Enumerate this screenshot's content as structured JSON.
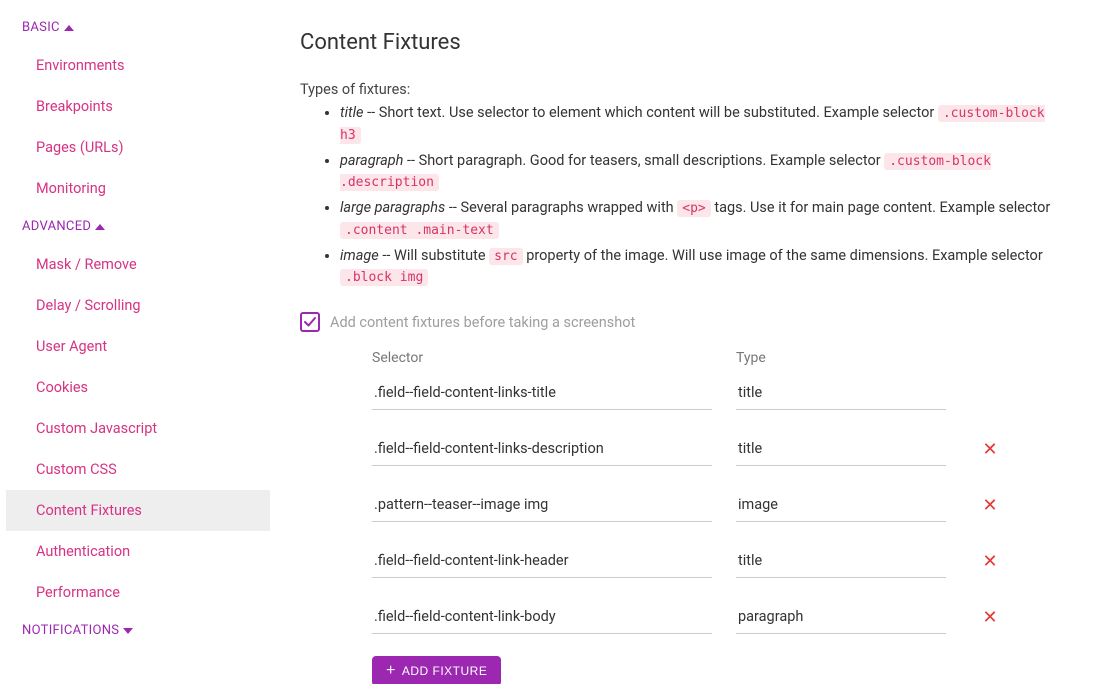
{
  "sidebar": {
    "sections": [
      {
        "label": "BASIC",
        "expanded": true,
        "items": [
          {
            "label": "Environments"
          },
          {
            "label": "Breakpoints"
          },
          {
            "label": "Pages (URLs)"
          },
          {
            "label": "Monitoring"
          }
        ]
      },
      {
        "label": "ADVANCED",
        "expanded": true,
        "items": [
          {
            "label": "Mask / Remove"
          },
          {
            "label": "Delay / Scrolling"
          },
          {
            "label": "User Agent"
          },
          {
            "label": "Cookies"
          },
          {
            "label": "Custom Javascript"
          },
          {
            "label": "Custom CSS"
          },
          {
            "label": "Content Fixtures",
            "active": true
          },
          {
            "label": "Authentication"
          },
          {
            "label": "Performance"
          }
        ]
      },
      {
        "label": "NOTIFICATIONS",
        "expanded": false,
        "items": []
      }
    ]
  },
  "page": {
    "title": "Content Fixtures",
    "intro": "Types of fixtures:",
    "types": [
      {
        "name": "title",
        "desc": " -- Short text. Use selector to element which content will be substituted. Example selector ",
        "code": ".custom-block h3"
      },
      {
        "name": "paragraph",
        "desc": " -- Short paragraph. Good for teasers, small descriptions. Example selector ",
        "code": ".custom-block .description"
      },
      {
        "name": "large paragraphs",
        "desc_pre": " -- Several paragraphs wrapped with ",
        "mid_code": "<p>",
        "desc_post": " tags. Use it for main page content. Example selector ",
        "code": ".content .main-text"
      },
      {
        "name": "image",
        "desc_pre": " -- Will substitute ",
        "mid_code": "src",
        "desc_post": " property of the image. Will use image of the same dimensions. Example selector ",
        "code": ".block img"
      }
    ],
    "checkbox_label": "Add content fixtures before taking a screenshot",
    "checkbox_checked": true,
    "table": {
      "headers": {
        "selector": "Selector",
        "type": "Type"
      },
      "rows": [
        {
          "selector": ".field--field-content-links-title",
          "type": "title",
          "deletable": false
        },
        {
          "selector": ".field--field-content-links-description",
          "type": "title",
          "deletable": true
        },
        {
          "selector": ".pattern--teaser--image img",
          "type": "image",
          "deletable": true
        },
        {
          "selector": ".field--field-content-link-header",
          "type": "title",
          "deletable": true
        },
        {
          "selector": ".field--field-content-link-body",
          "type": "paragraph",
          "deletable": true
        }
      ]
    },
    "add_button": "ADD FIXTURE"
  }
}
